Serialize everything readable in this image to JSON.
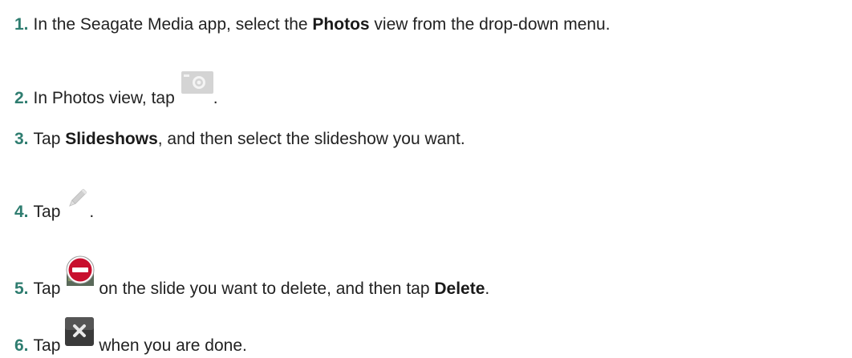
{
  "steps": [
    {
      "num": "1.",
      "pre": "In the Seagate Media app, select the ",
      "bold": "Photos",
      "post": " view from the drop-down menu."
    },
    {
      "num": "2.",
      "pre": "In Photos view, tap",
      "icon": "camera-icon",
      "post": "."
    },
    {
      "num": "3.",
      "pre": "Tap ",
      "bold": "Slideshows",
      "post": ", and then select the slideshow you want."
    },
    {
      "num": "4.",
      "pre": "Tap",
      "icon": "pencil-icon",
      "post": "."
    },
    {
      "num": "5.",
      "pre": "Tap",
      "icon": "delete-icon",
      "mid": "on the slide you want to delete, and then tap ",
      "bold": "Delete",
      "post": "."
    },
    {
      "num": "6.",
      "pre": "Tap",
      "icon": "close-icon",
      "post": "when you are done."
    }
  ],
  "colors": {
    "step_number": "#2f7d70",
    "text": "#222222",
    "delete_red": "#c8102e",
    "close_dark": "#3a3a3a"
  }
}
